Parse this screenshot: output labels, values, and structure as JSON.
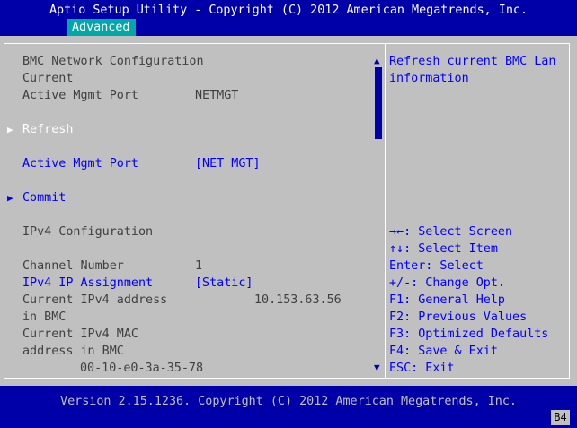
{
  "header": {
    "title": "Aptio Setup Utility - Copyright (C) 2012 American Megatrends, Inc.",
    "tabs": [
      {
        "label": "Advanced"
      }
    ]
  },
  "main": {
    "section_title": "BMC Network Configuration",
    "current_label": "Current",
    "active_port_label": "Active Mgmt Port",
    "active_port_value": "NETMGT",
    "refresh_label": "Refresh",
    "active_port_option_label": "Active Mgmt Port",
    "active_port_option_value": "[NET MGT]",
    "commit_label": "Commit",
    "ipv4_heading": "IPv4 Configuration",
    "channel_label": "Channel Number",
    "channel_value": "1",
    "ip_assignment_label": "IPv4 IP Assignment",
    "ip_assignment_value": "[Static]",
    "ipv4_address_label_1": "Current IPv4 address",
    "ipv4_address_label_2": "in BMC",
    "ipv4_address_value": "10.153.63.56",
    "mac_label_1": "Current IPv4 MAC",
    "mac_label_2": "address in BMC",
    "mac_value": "00-10-e0-3a-35-78"
  },
  "help": {
    "text_1": "Refresh current BMC Lan",
    "text_2": "information",
    "keys": [
      "→←: Select Screen",
      "↑↓: Select Item",
      "Enter: Select",
      "+/-: Change Opt.",
      "F1: General Help",
      "F2: Previous Values",
      "F3: Optimized Defaults",
      "F4: Save & Exit",
      "ESC: Exit"
    ]
  },
  "footer": {
    "version": "Version 2.15.1236. Copyright (C) 2012 American Megatrends, Inc.",
    "badge": "B4"
  },
  "colors": {
    "background": "#0000a8",
    "panel": "#c0c0c0",
    "tab": "#00a8a8",
    "option": "#0000ff",
    "selected": "#ffffff"
  },
  "icons": {
    "submenu_arrow": "triangle-right-icon",
    "scroll_up": "triangle-up-icon",
    "scroll_down": "triangle-down-icon"
  }
}
